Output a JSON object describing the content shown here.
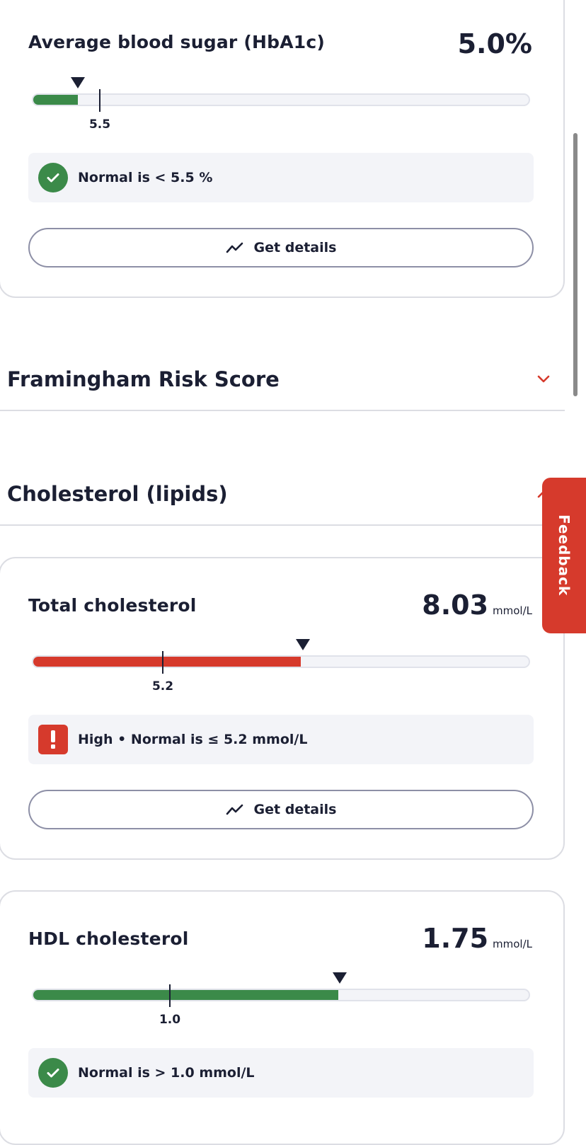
{
  "colors": {
    "normal": "#3b8a49",
    "high": "#d63a2c",
    "text": "#1b1f33",
    "track": "#f3f4f8"
  },
  "hba1c": {
    "title": "Average blood sugar (HbA1c)",
    "value": "5.0%",
    "reference_label": "5.5",
    "fill_fraction": 0.09,
    "status_icon": "check-icon",
    "status_text": "Normal is < 5.5 %",
    "details_label": "Get details",
    "details_icon": "trend-icon"
  },
  "framingham": {
    "title": "Framingham Risk Score",
    "state": "collapsed",
    "icon": "chevron-down-icon"
  },
  "cholesterol_section": {
    "title": "Cholesterol (lipids)",
    "state": "expanded",
    "icon": "chevron-up-icon"
  },
  "total_cholesterol": {
    "title": "Total cholesterol",
    "value": "8.03",
    "unit": "mmol/L",
    "reference_label": "5.2",
    "fill_fraction": 0.54,
    "status_icon": "alert-icon",
    "status_text": "High • Normal is ≤ 5.2 mmol/L",
    "details_label": "Get details",
    "details_icon": "trend-icon"
  },
  "hdl": {
    "title": "HDL cholesterol",
    "value": "1.75",
    "unit": "mmol/L",
    "reference_label": "1.0",
    "fill_fraction": 0.615,
    "status_icon": "check-icon",
    "status_text": "Normal is > 1.0 mmol/L"
  },
  "feedback": {
    "label": "Feedback"
  }
}
